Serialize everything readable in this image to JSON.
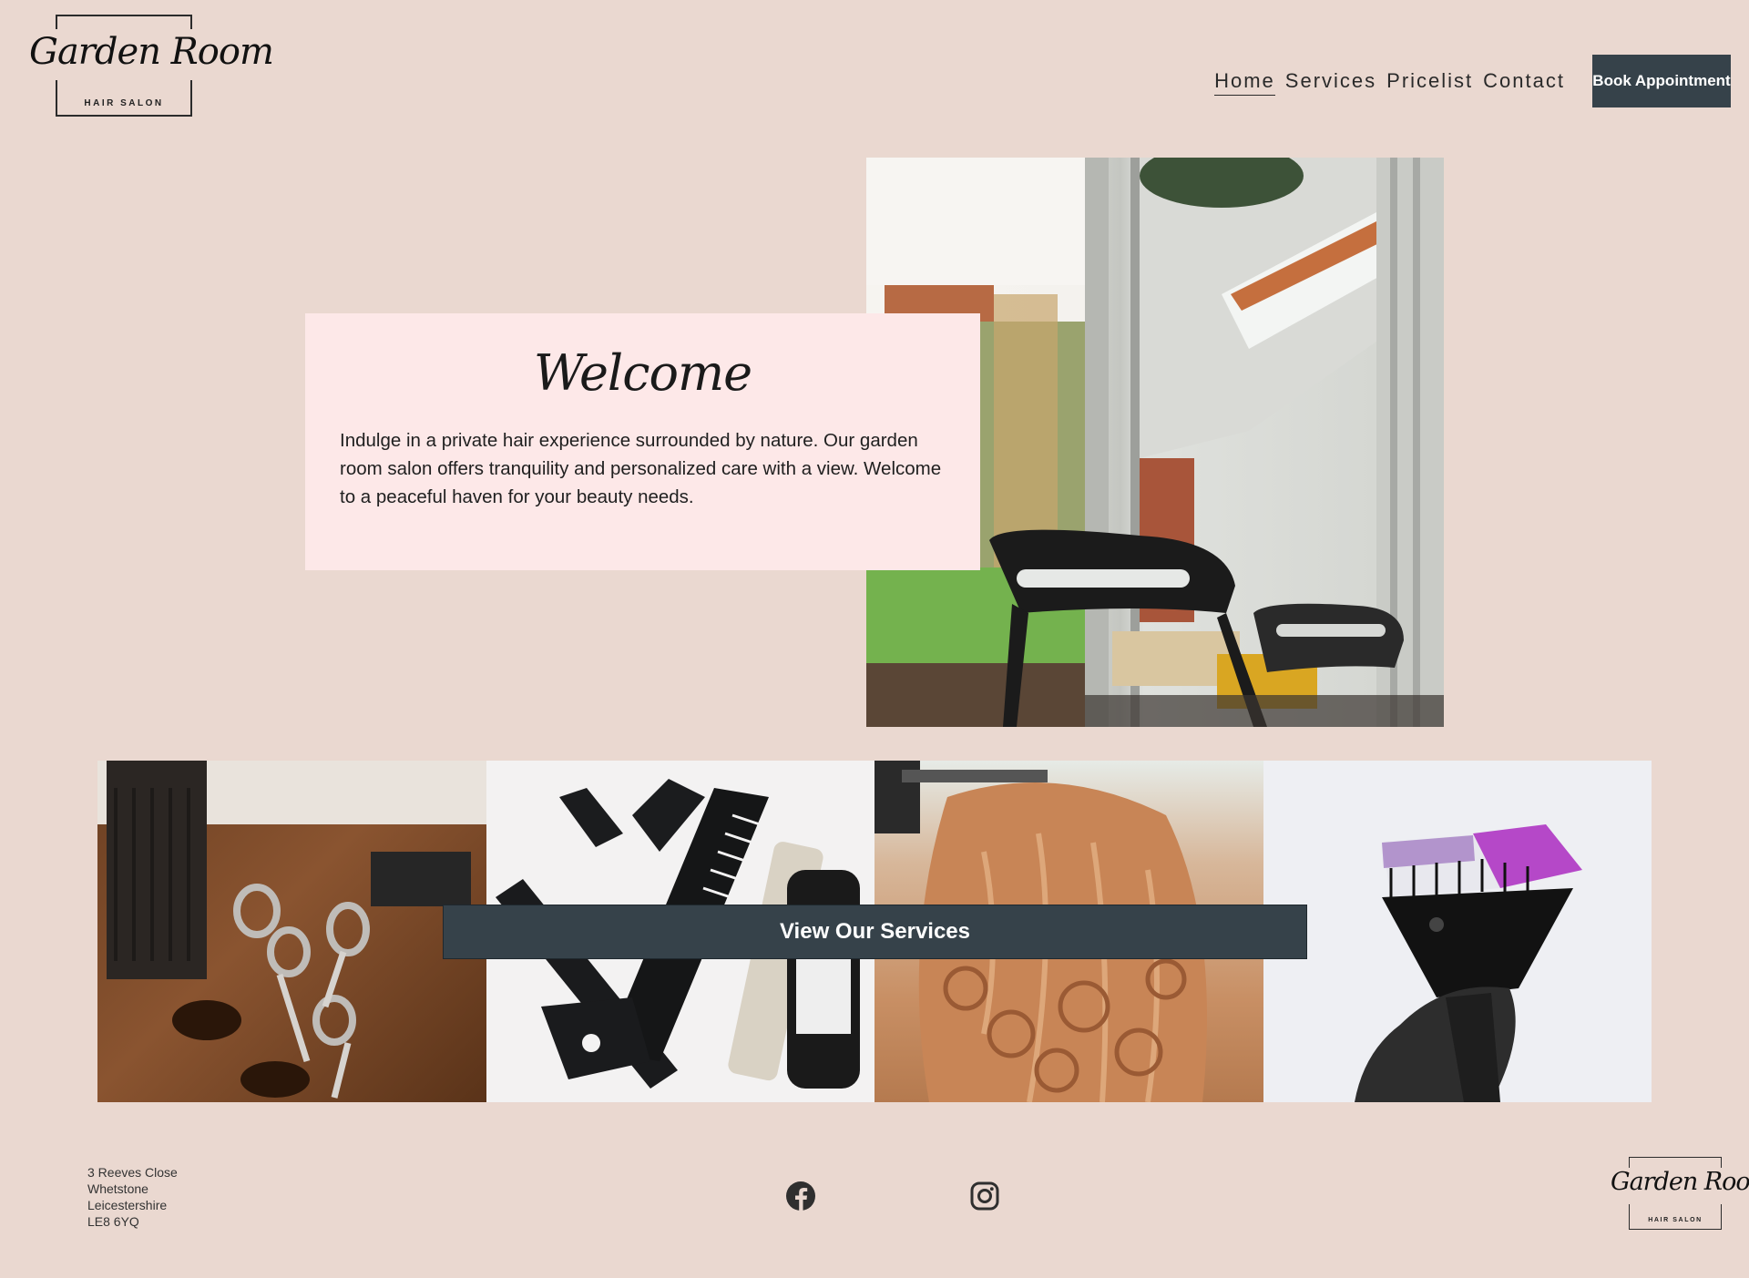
{
  "brand": {
    "name": "Garden Room",
    "tagline": "HAIR SALON"
  },
  "nav": {
    "items": [
      {
        "label": "Home",
        "active": true
      },
      {
        "label": "Services",
        "active": false
      },
      {
        "label": "Pricelist",
        "active": false
      },
      {
        "label": "Contact",
        "active": false
      }
    ],
    "book_button": "Book Appointment"
  },
  "hero": {
    "title": "Welcome",
    "text": "Indulge in a private hair experience surrounded by nature. Our garden room salon offers tranquility and personalized care with a view. Welcome to a peaceful haven for your beauty needs."
  },
  "gallery": {
    "button": "View Our Services"
  },
  "footer": {
    "address": [
      "3 Reeves Close",
      "Whetstone",
      "Leicestershire",
      "LE8 6YQ"
    ],
    "social_icons": [
      "facebook-icon",
      "instagram-icon"
    ]
  },
  "colors": {
    "background": "#ead8d0",
    "card": "#fde8e8",
    "button": "#36424a"
  }
}
